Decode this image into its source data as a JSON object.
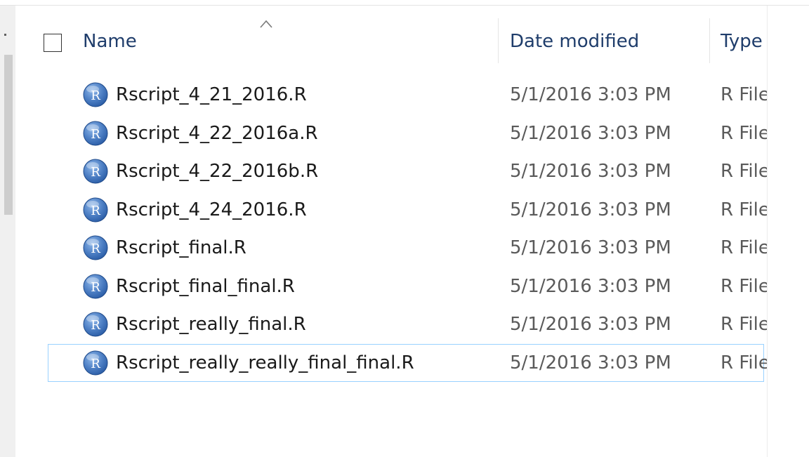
{
  "columns": {
    "name": "Name",
    "date": "Date modified",
    "type": "Type"
  },
  "icons": {
    "file": "r-file-icon",
    "sort": "sort-ascending-icon"
  },
  "colors": {
    "icon_blue": "#2d5fa8",
    "icon_light": "#8fb8ea",
    "selection_border": "#99d1ff"
  },
  "files": [
    {
      "name": "Rscript_4_21_2016.R",
      "date": "5/1/2016 3:03 PM",
      "type": "R File"
    },
    {
      "name": "Rscript_4_22_2016a.R",
      "date": "5/1/2016 3:03 PM",
      "type": "R File"
    },
    {
      "name": "Rscript_4_22_2016b.R",
      "date": "5/1/2016 3:03 PM",
      "type": "R File"
    },
    {
      "name": "Rscript_4_24_2016.R",
      "date": "5/1/2016 3:03 PM",
      "type": "R File"
    },
    {
      "name": "Rscript_final.R",
      "date": "5/1/2016 3:03 PM",
      "type": "R File"
    },
    {
      "name": "Rscript_final_final.R",
      "date": "5/1/2016 3:03 PM",
      "type": "R File"
    },
    {
      "name": "Rscript_really_final.R",
      "date": "5/1/2016 3:03 PM",
      "type": "R File"
    },
    {
      "name": "Rscript_really_really_final_final.R",
      "date": "5/1/2016 3:03 PM",
      "type": "R File",
      "selected": true
    }
  ]
}
